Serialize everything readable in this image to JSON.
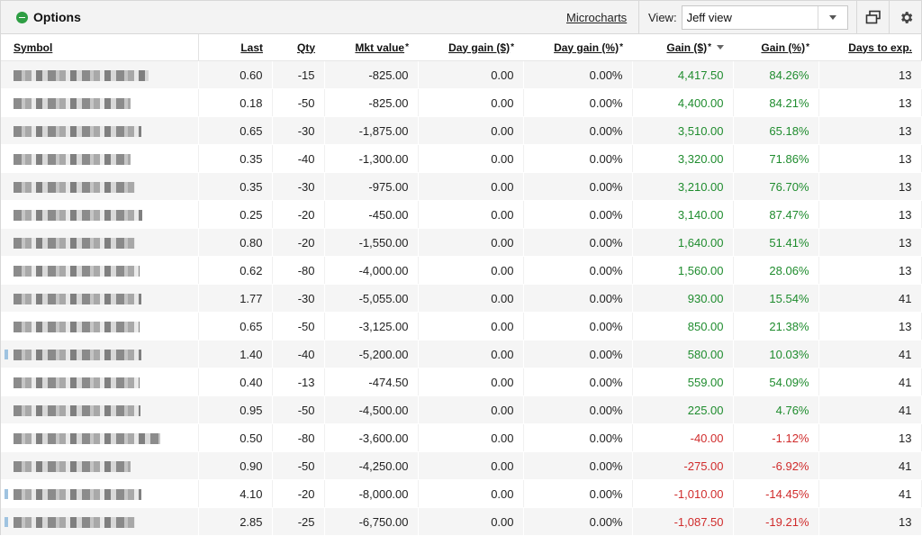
{
  "header": {
    "title": "Options",
    "microcharts_label": "Microcharts",
    "view_label": "View:",
    "view_value": "Jeff view",
    "accent": "#2e9e44"
  },
  "columns": {
    "symbol": "Symbol",
    "last": "Last",
    "qty": "Qty",
    "mkt_value": "Mkt value",
    "day_gain": "Day gain ($)",
    "day_gain_pct": "Day gain (%)",
    "gain": "Gain ($)",
    "gain_pct": "Gain (%)",
    "days_to_exp": "Days to exp.",
    "star": "*"
  },
  "rows": [
    {
      "last": "0.60",
      "qty": "-15",
      "mkt": "-825.00",
      "dg": "0.00",
      "dgp": "0.00%",
      "g": "4,417.50",
      "gp": "84.26%",
      "days": "13"
    },
    {
      "last": "0.18",
      "qty": "-50",
      "mkt": "-825.00",
      "dg": "0.00",
      "dgp": "0.00%",
      "g": "4,400.00",
      "gp": "84.21%",
      "days": "13"
    },
    {
      "last": "0.65",
      "qty": "-30",
      "mkt": "-1,875.00",
      "dg": "0.00",
      "dgp": "0.00%",
      "g": "3,510.00",
      "gp": "65.18%",
      "days": "13"
    },
    {
      "last": "0.35",
      "qty": "-40",
      "mkt": "-1,300.00",
      "dg": "0.00",
      "dgp": "0.00%",
      "g": "3,320.00",
      "gp": "71.86%",
      "days": "13"
    },
    {
      "last": "0.35",
      "qty": "-30",
      "mkt": "-975.00",
      "dg": "0.00",
      "dgp": "0.00%",
      "g": "3,210.00",
      "gp": "76.70%",
      "days": "13"
    },
    {
      "last": "0.25",
      "qty": "-20",
      "mkt": "-450.00",
      "dg": "0.00",
      "dgp": "0.00%",
      "g": "3,140.00",
      "gp": "87.47%",
      "days": "13"
    },
    {
      "last": "0.80",
      "qty": "-20",
      "mkt": "-1,550.00",
      "dg": "0.00",
      "dgp": "0.00%",
      "g": "1,640.00",
      "gp": "51.41%",
      "days": "13"
    },
    {
      "last": "0.62",
      "qty": "-80",
      "mkt": "-4,000.00",
      "dg": "0.00",
      "dgp": "0.00%",
      "g": "1,560.00",
      "gp": "28.06%",
      "days": "13"
    },
    {
      "last": "1.77",
      "qty": "-30",
      "mkt": "-5,055.00",
      "dg": "0.00",
      "dgp": "0.00%",
      "g": "930.00",
      "gp": "15.54%",
      "days": "41"
    },
    {
      "last": "0.65",
      "qty": "-50",
      "mkt": "-3,125.00",
      "dg": "0.00",
      "dgp": "0.00%",
      "g": "850.00",
      "gp": "21.38%",
      "days": "13"
    },
    {
      "last": "1.40",
      "qty": "-40",
      "mkt": "-5,200.00",
      "dg": "0.00",
      "dgp": "0.00%",
      "g": "580.00",
      "gp": "10.03%",
      "days": "41"
    },
    {
      "last": "0.40",
      "qty": "-13",
      "mkt": "-474.50",
      "dg": "0.00",
      "dgp": "0.00%",
      "g": "559.00",
      "gp": "54.09%",
      "days": "41"
    },
    {
      "last": "0.95",
      "qty": "-50",
      "mkt": "-4,500.00",
      "dg": "0.00",
      "dgp": "0.00%",
      "g": "225.00",
      "gp": "4.76%",
      "days": "41"
    },
    {
      "last": "0.50",
      "qty": "-80",
      "mkt": "-3,600.00",
      "dg": "0.00",
      "dgp": "0.00%",
      "g": "-40.00",
      "gp": "-1.12%",
      "days": "13"
    },
    {
      "last": "0.90",
      "qty": "-50",
      "mkt": "-4,250.00",
      "dg": "0.00",
      "dgp": "0.00%",
      "g": "-275.00",
      "gp": "-6.92%",
      "days": "41"
    },
    {
      "last": "4.10",
      "qty": "-20",
      "mkt": "-8,000.00",
      "dg": "0.00",
      "dgp": "0.00%",
      "g": "-1,010.00",
      "gp": "-14.45%",
      "days": "41"
    },
    {
      "last": "2.85",
      "qty": "-25",
      "mkt": "-6,750.00",
      "dg": "0.00",
      "dgp": "0.00%",
      "g": "-1,087.50",
      "gp": "-19.21%",
      "days": "13"
    }
  ],
  "colors": {
    "gain_positive": "#1f8c2e",
    "gain_negative": "#d02c2c"
  }
}
